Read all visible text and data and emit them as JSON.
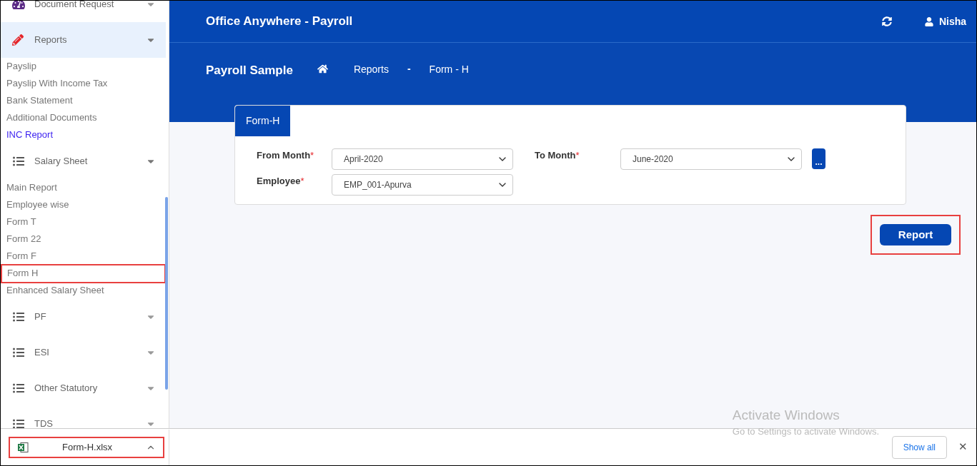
{
  "sidebar": {
    "groups": [
      {
        "label": "Document Request",
        "kind": "dashboard",
        "selected": false,
        "expanded": false
      },
      {
        "label": "Reports",
        "kind": "pencil",
        "selected": true,
        "expanded": true,
        "children": [
          {
            "label": "Payslip",
            "selected": false,
            "highlighted": false
          },
          {
            "label": "Payslip With Income Tax",
            "selected": false,
            "highlighted": false
          },
          {
            "label": "Bank Statement",
            "selected": false,
            "highlighted": false
          },
          {
            "label": "Additional Documents",
            "selected": false,
            "highlighted": false
          },
          {
            "label": "INC Report",
            "selected": true,
            "highlighted": false
          }
        ]
      },
      {
        "label": "Salary Sheet",
        "kind": "list",
        "selected": false,
        "expanded": true,
        "children": [
          {
            "label": "Main Report",
            "selected": false,
            "highlighted": false
          },
          {
            "label": "Employee wise",
            "selected": false,
            "highlighted": false
          },
          {
            "label": "Form T",
            "selected": false,
            "highlighted": false
          },
          {
            "label": "Form 22",
            "selected": false,
            "highlighted": false
          },
          {
            "label": "Form F",
            "selected": false,
            "highlighted": false
          },
          {
            "label": "Form H",
            "selected": false,
            "highlighted": true
          },
          {
            "label": "Enhanced Salary Sheet",
            "selected": false,
            "highlighted": false
          }
        ]
      },
      {
        "label": "PF",
        "kind": "list",
        "selected": false,
        "expanded": false
      },
      {
        "label": "ESI",
        "kind": "list",
        "selected": false,
        "expanded": false
      },
      {
        "label": "Other Statutory",
        "kind": "list",
        "selected": false,
        "expanded": false
      },
      {
        "label": "TDS",
        "kind": "list",
        "selected": false,
        "expanded": false
      }
    ]
  },
  "header": {
    "app_title": "Office Anywhere - Payroll",
    "user": "Nisha"
  },
  "breadcrumb": {
    "company": "Payroll Sample",
    "items": [
      "Reports",
      "Form - H"
    ],
    "separator": "-"
  },
  "form": {
    "tab": "Form-H",
    "fields": [
      {
        "label": "From Month",
        "required": true,
        "value": "April-2020"
      },
      {
        "label": "To Month",
        "required": true,
        "value": "June-2020"
      },
      {
        "label": "Employee",
        "required": true,
        "value": "EMP_001-Apurva"
      }
    ],
    "more_button": "...",
    "required_mark": "*"
  },
  "report_button": {
    "label": "Report",
    "highlighted": true
  },
  "os_notice": {
    "title": "Activate Windows",
    "text": "Go to Settings to activate Windows."
  },
  "download_bar": {
    "file": "Form-H.xlsx",
    "highlighted": true,
    "show_all": "Show all",
    "close": "✕"
  }
}
